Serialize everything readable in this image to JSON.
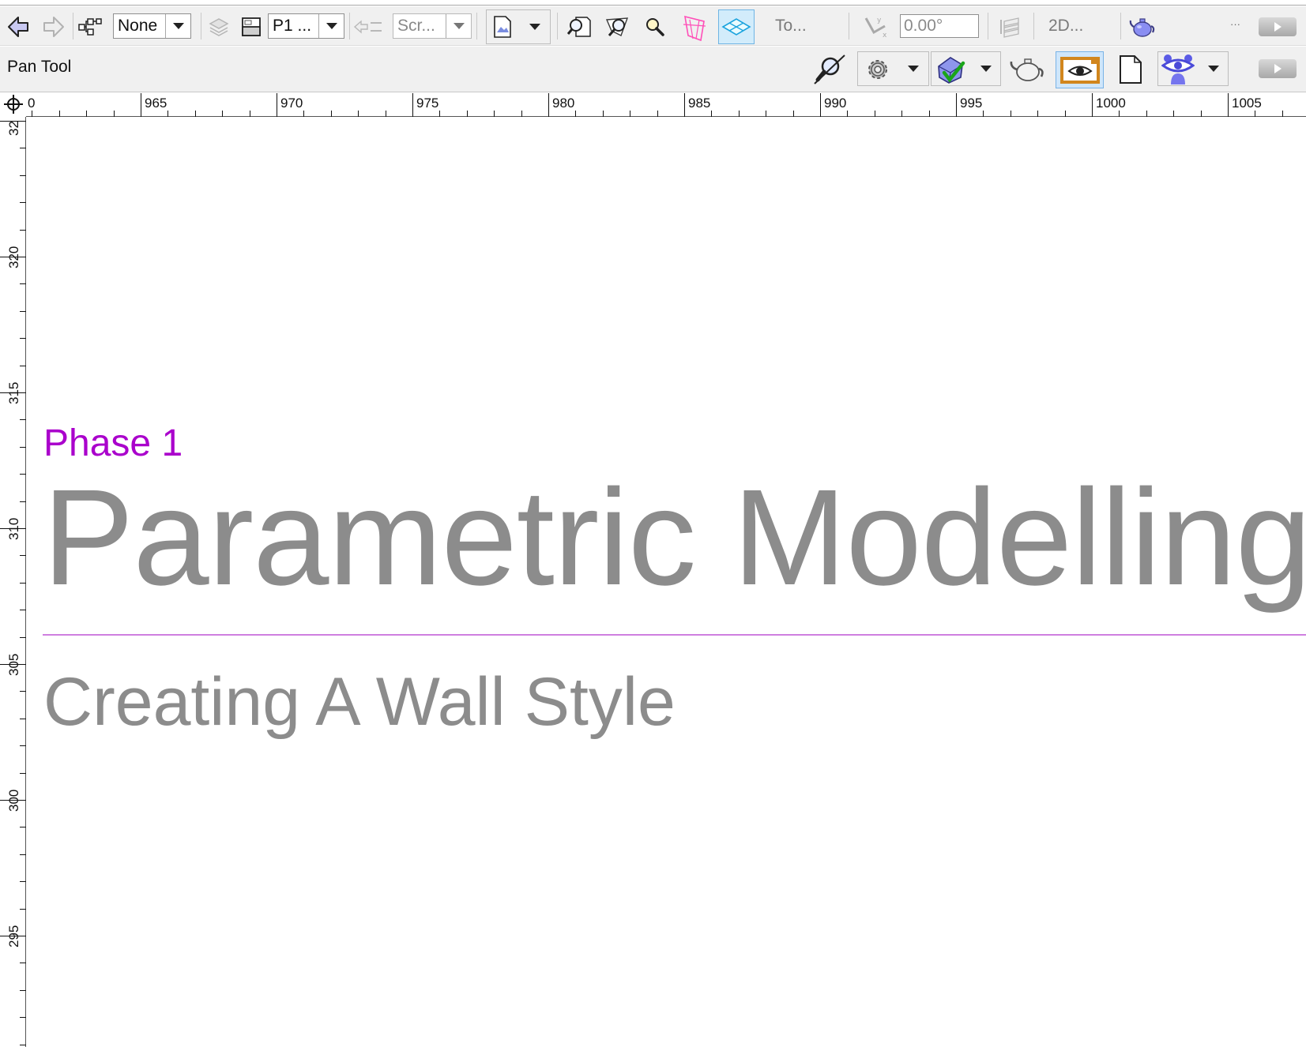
{
  "toolbar1": {
    "class_combo": "None",
    "layer_combo": "P1 ...",
    "view_combo": "Scr...",
    "top_plan_label": "To...",
    "rotation_value": "0.00°",
    "render_mode_label": "2D...",
    "more_label": "···"
  },
  "toolbar2": {
    "tool_name": "Pan Tool"
  },
  "ruler": {
    "horizontal": [
      "0",
      "965",
      "970",
      "975",
      "980",
      "985",
      "990",
      "995",
      "1000",
      "1005"
    ],
    "vertical": [
      "32",
      "320",
      "315",
      "310",
      "305",
      "300",
      "295"
    ]
  },
  "document": {
    "phase": "Phase 1",
    "title": "Parametric Modelling",
    "subtitle": "Creating A Wall Style"
  },
  "colors": {
    "accent_purple": "#aa00cc",
    "divider": "#cf7fe0",
    "title_gray": "#8c8c8c",
    "toolbar_bg": "#f0f0f0"
  }
}
